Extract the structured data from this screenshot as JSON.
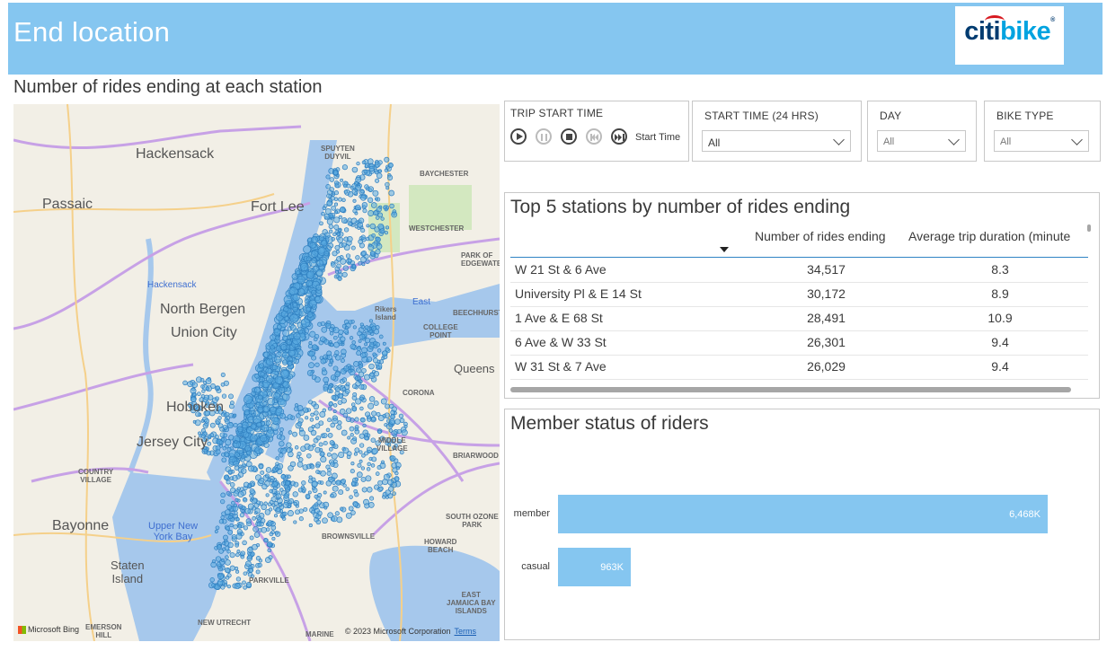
{
  "header": {
    "title": "End location",
    "logo": {
      "part1": "citi",
      "part2": "bike",
      "reg": "®"
    }
  },
  "map": {
    "title": "Number of rides ending at each station",
    "labels": {
      "hackensack": "Hackensack",
      "passaic": "Passaic",
      "fort_lee": "Fort Lee",
      "north_bergen": "North Bergen",
      "union_city": "Union City",
      "hoboken": "Hoboken",
      "jersey_city": "Jersey City",
      "bayonne": "Bayonne",
      "staten_island": "Staten\nIsland",
      "queens": "Queens",
      "upper_ny_bay": "Upper New\nYork Bay",
      "hackensack_river": "Hackensack",
      "east_river": "East",
      "spuyten": "SPUYTEN\nDUYVIL",
      "baychester": "BAYCHESTER",
      "westchester": "WESTCHESTER",
      "park_edgewater": "PARK OF\nEDGEWATE",
      "rikers": "Rikers\nIsland",
      "beechhurst": "BEECHHURST",
      "college_point": "COLLEGE\nPOINT",
      "corona": "CORONA",
      "middle_village": "MIDDLE\nVILLAGE",
      "briarwood": "BRIARWOOD",
      "country_village": "COUNTRY\nVILLAGE",
      "south_ozone": "SOUTH OZONE\nPARK",
      "howard_beach": "HOWARD\nBEACH",
      "brownsville": "BROWNSVILLE",
      "parkville": "PARKVILLE",
      "east_jamaica": "EAST\nJAMAICA BAY\nISLANDS",
      "new_utrecht": "NEW UTRECHT",
      "emerson_hill": "EMERSON\nHILL",
      "marine": "MARINE"
    },
    "footer_left": "Microsoft Bing",
    "footer_right": "© 2023 Microsoft Corporation",
    "terms": "Terms"
  },
  "slicers": {
    "trip_start": {
      "title": "TRIP START TIME",
      "play_label": "Start Time"
    },
    "start_time": {
      "title": "START TIME (24 HRS)",
      "value": "All"
    },
    "day": {
      "title": "DAY",
      "value": "All"
    },
    "bike_type": {
      "title": "BIKE TYPE",
      "value": "All"
    }
  },
  "top5": {
    "title": "Top 5 stations by number of rides ending",
    "columns": [
      "",
      "Number of rides ending",
      "Average trip duration (minute"
    ],
    "rows": [
      {
        "station": "W 21 St & 6 Ave",
        "rides": "34,517",
        "duration": "8.3"
      },
      {
        "station": "University Pl & E 14 St",
        "rides": "30,172",
        "duration": "8.9"
      },
      {
        "station": "1 Ave & E 68 St",
        "rides": "28,491",
        "duration": "10.9"
      },
      {
        "station": "6 Ave & W 33 St",
        "rides": "26,301",
        "duration": "9.4"
      },
      {
        "station": "W 31 St & 7 Ave",
        "rides": "26,029",
        "duration": "9.4"
      }
    ]
  },
  "member": {
    "title": "Member status of riders",
    "chart_data": {
      "type": "bar",
      "orientation": "horizontal",
      "categories": [
        "member",
        "casual"
      ],
      "values": [
        6468000,
        963000
      ],
      "data_labels": [
        "6,468K",
        "963K"
      ]
    }
  },
  "colors": {
    "header_bg": "#85c6f0",
    "bar": "#85c6f0",
    "station_dot": "#5aa9e0",
    "table_header_line": "#2f83c4"
  }
}
